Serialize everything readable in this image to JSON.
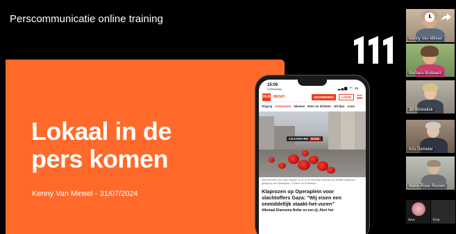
{
  "window": {
    "title": "Perscommunicatie online training"
  },
  "slide": {
    "headline_line1": "Lokaal in de",
    "headline_line2": "pers komen",
    "byline": "Kenny Van Minsel - 31/07/2024",
    "brand_logo_icon": "111-logo-icon",
    "accent_color": "#ff6a2a"
  },
  "phone": {
    "status_time": "15:05",
    "status_sub": "◂ WhatsApp",
    "status_icons": "▂▄▆ ◠ ▭",
    "logo_text": "HLN",
    "region_label": "REGIO",
    "subscribe_label": "ABONNEREN",
    "login_label": "LOGIN",
    "nav_items": [
      "Wijgrig",
      "Antwerpen",
      "Nieuws",
      "Eten en drinken",
      "Uit-tips",
      "Leuv"
    ],
    "photo_banner_prefix": "CEASEFIRE",
    "photo_banner_word": "NOW",
    "caption": "Actievoerders van onder andere 11.11.11 en Amnesty International leidden klaprozen gelegd op het Operaplein. © Kiano De Schaetzen",
    "article_title": "Klaprozen op Operaplein voor slachtoffers Gaza: \"Wij eisen een onmiddellijk staakt-het-vuren\"",
    "article_teaser": "Alkmaal Klarosma Nofar en een jij. Alert het"
  },
  "participants": [
    {
      "name": "Kenny Van Minsel"
    },
    {
      "name": "Barbara Brabaant"
    },
    {
      "name": "Jill Winnelink"
    },
    {
      "name": "Kris Demeter"
    },
    {
      "name": "Marie-Rose Rossen"
    }
  ],
  "small_participants": [
    {
      "name": "Ann"
    },
    {
      "name": "Kris"
    }
  ],
  "overlay": {
    "clock_icon": "clock-icon",
    "share_icon": "share-arrow-icon"
  }
}
